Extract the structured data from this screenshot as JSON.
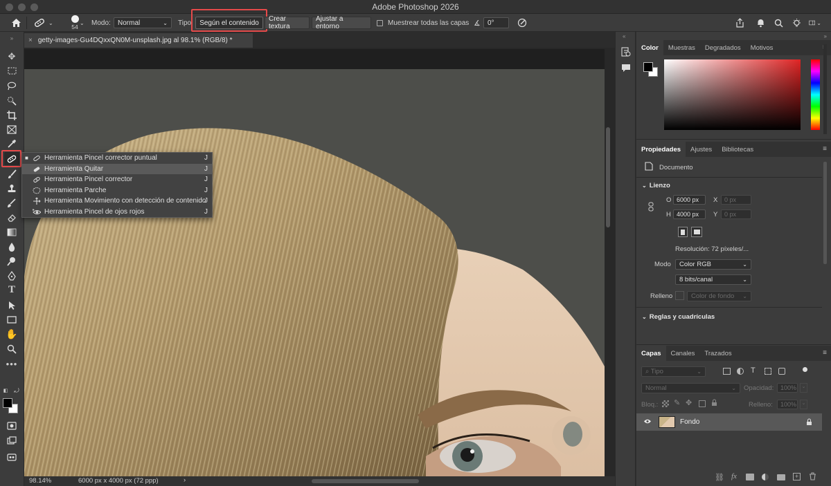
{
  "app": {
    "title": "Adobe Photoshop 2026"
  },
  "options_bar": {
    "brush_size": "54",
    "mode_label": "Modo:",
    "mode_value": "Normal",
    "type_label": "Tipo:",
    "type_content_aware": "Según el contenido",
    "type_create_texture": "Crear textura",
    "type_proximity_match": "Ajustar a entorno",
    "sample_all_layers": "Muestrear todas las capas",
    "angle_value": "0°"
  },
  "document": {
    "tab_title": "getty-images-Gu4DQxxQN0M-unsplash.jpg al 98.1% (RGB/8) *",
    "zoom": "98.14%",
    "doc_info": "6000 px x 4000 px (72 ppp)"
  },
  "tool_flyout": {
    "items": [
      {
        "label": "Herramienta Pincel corrector puntual",
        "key": "J",
        "icon": "spot-healing-icon",
        "selected": true
      },
      {
        "label": "Herramienta Quitar",
        "key": "J",
        "icon": "remove-tool-icon",
        "hover": true
      },
      {
        "label": "Herramienta Pincel corrector",
        "key": "J",
        "icon": "healing-brush-icon"
      },
      {
        "label": "Herramienta Parche",
        "key": "J",
        "icon": "patch-icon"
      },
      {
        "label": "Herramienta Movimiento con detección de contenido",
        "key": "J",
        "icon": "content-aware-move-icon"
      },
      {
        "label": "Herramienta Pincel de ojos rojos",
        "key": "J",
        "icon": "red-eye-icon"
      }
    ]
  },
  "color_panel": {
    "tabs": [
      "Color",
      "Muestras",
      "Degradados",
      "Motivos"
    ],
    "active_tab": "Color",
    "hue_color": "#e02424"
  },
  "properties_panel": {
    "tabs": [
      "Propiedades",
      "Ajustes",
      "Bibliotecas"
    ],
    "active_tab": "Propiedades",
    "kind": "Documento",
    "canvas_section": "Lienzo",
    "width_label": "O",
    "width_value": "6000 px",
    "height_label": "H",
    "height_value": "4000 px",
    "x_label": "X",
    "x_placeholder": "0 px",
    "y_label": "Y",
    "y_placeholder": "0 px",
    "resolution": "Resolución: 72 píxeles/...",
    "mode_label": "Modo",
    "mode_value": "Color RGB",
    "bits_value": "8 bits/canal",
    "fill_label": "Relleno",
    "fill_value": "Color de fondo",
    "rulers_section": "Reglas y cuadrículas"
  },
  "layers_panel": {
    "tabs": [
      "Capas",
      "Canales",
      "Trazados"
    ],
    "active_tab": "Capas",
    "filter_placeholder": "Tipo",
    "blend_mode": "Normal",
    "opacity_label": "Opacidad:",
    "opacity_value": "100%",
    "lock_label": "Bloq.:",
    "fill_label": "Relleno:",
    "fill_value": "100%",
    "layers": [
      {
        "name": "Fondo",
        "locked": true,
        "visible": true
      }
    ]
  },
  "colors": {
    "highlight": "#e64a4a",
    "panel": "#3c3c3c",
    "canvas_bg": "#4e4f4b"
  }
}
